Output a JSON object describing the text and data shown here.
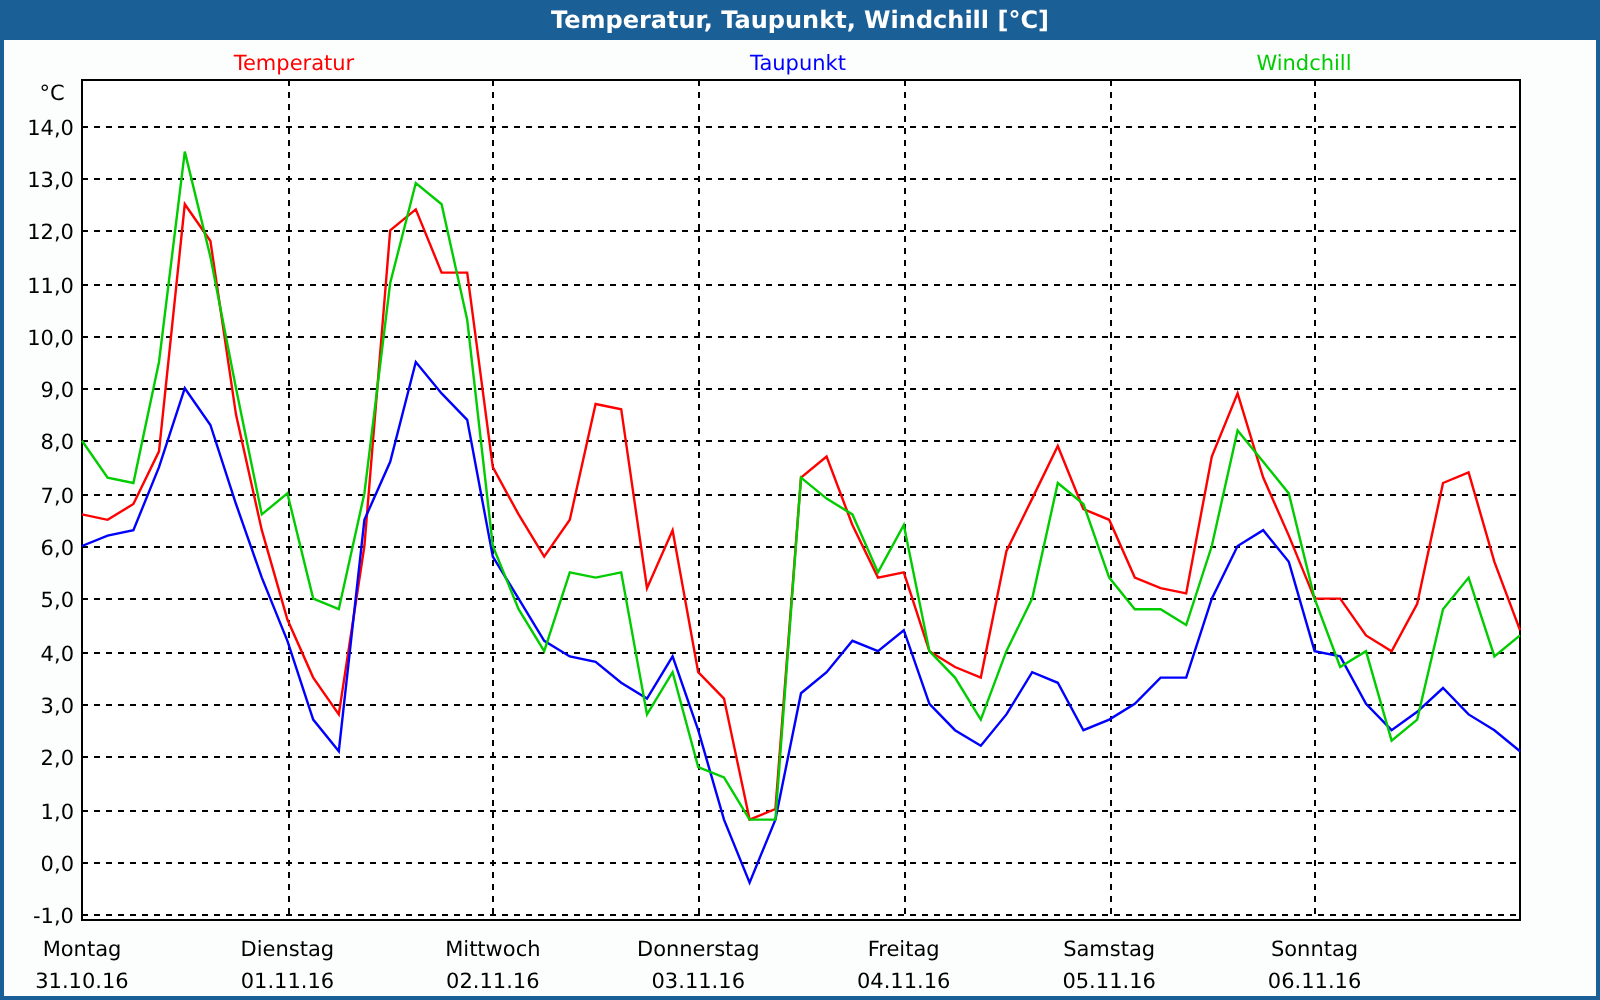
{
  "window": {
    "title": "Temperatur, Taupunkt, Windchill [°C]"
  },
  "chart": {
    "unit_label": "°C",
    "dates": [
      "31.10.16",
      "01.11.16",
      "02.11.16",
      "03.11.16",
      "04.11.16",
      "05.11.16",
      "06.11.16"
    ],
    "chart_data": {
      "type": "line",
      "categories": [
        "Montag",
        null,
        null,
        null,
        null,
        null,
        null,
        null,
        "Dienstag",
        null,
        null,
        null,
        null,
        null,
        null,
        null,
        "Mittwoch",
        null,
        null,
        null,
        null,
        null,
        null,
        null,
        "Donnerstag",
        null,
        null,
        null,
        null,
        null,
        null,
        null,
        "Freitag",
        null,
        null,
        null,
        null,
        null,
        null,
        null,
        "Samstag",
        null,
        null,
        null,
        null,
        null,
        null,
        null,
        "Sonntag",
        null,
        null,
        null,
        null,
        null,
        null,
        null,
        null
      ],
      "ylim": [
        -1.11,
        14.86
      ],
      "grid": true,
      "yticks": [
        {
          "value": 14,
          "label": "14,0"
        },
        {
          "value": 13,
          "label": "13,0"
        },
        {
          "value": 12,
          "label": "12,0"
        },
        {
          "value": 11,
          "label": "11,0"
        },
        {
          "value": 10,
          "label": "10,0"
        },
        {
          "value": 9,
          "label": "9,0"
        },
        {
          "value": 8,
          "label": "8,0"
        },
        {
          "value": 7,
          "label": "7,0"
        },
        {
          "value": 6,
          "label": "6,0"
        },
        {
          "value": 5,
          "label": "5,0"
        },
        {
          "value": 4,
          "label": "4,0"
        },
        {
          "value": 3,
          "label": "3,0"
        },
        {
          "value": 2,
          "label": "2,0"
        },
        {
          "value": 1,
          "label": "1,0"
        },
        {
          "value": 0,
          "label": "0,0"
        },
        {
          "value": -1,
          "label": "-1,0"
        }
      ],
      "series": [
        {
          "name": "Temperatur",
          "color": "#ff0000",
          "values": [
            6.6,
            6.5,
            6.8,
            7.8,
            12.5,
            11.8,
            8.5,
            6.3,
            4.6,
            3.5,
            2.8,
            6.0,
            12.0,
            12.4,
            11.2,
            11.2,
            7.5,
            6.6,
            5.8,
            6.5,
            8.7,
            8.6,
            5.2,
            6.3,
            3.6,
            3.1,
            0.8,
            1.0,
            7.3,
            7.7,
            6.4,
            5.4,
            5.5,
            4.0,
            3.7,
            3.5,
            5.9,
            6.9,
            7.9,
            6.7,
            6.5,
            5.4,
            5.2,
            5.1,
            7.7,
            8.9,
            7.3,
            6.2,
            5.0,
            5.0,
            4.3,
            4.0,
            4.9,
            7.2,
            7.4,
            5.7,
            4.4
          ]
        },
        {
          "name": "Taupunkt",
          "color": "#0000ff",
          "values": [
            6.0,
            6.2,
            6.3,
            7.5,
            9.0,
            8.3,
            6.8,
            5.4,
            4.2,
            2.7,
            2.1,
            6.5,
            7.6,
            9.5,
            8.9,
            8.4,
            5.8,
            5.0,
            4.2,
            3.9,
            3.8,
            3.4,
            3.1,
            3.9,
            2.5,
            0.8,
            -0.4,
            0.8,
            3.2,
            3.6,
            4.2,
            4.0,
            4.4,
            3.0,
            2.5,
            2.2,
            2.8,
            3.6,
            3.4,
            2.5,
            2.7,
            3.0,
            3.5,
            3.5,
            5.0,
            6.0,
            6.3,
            5.7,
            4.0,
            3.9,
            3.0,
            2.5,
            2.85,
            3.3,
            2.8,
            2.5,
            2.1
          ]
        },
        {
          "name": "Windchill",
          "color": "#00cc00",
          "values": [
            8.0,
            7.3,
            7.2,
            9.5,
            13.5,
            11.5,
            9.0,
            6.6,
            7.0,
            5.0,
            4.8,
            7.0,
            11.0,
            12.9,
            12.5,
            10.3,
            6.0,
            4.8,
            4.0,
            5.5,
            5.4,
            5.5,
            2.8,
            3.6,
            1.8,
            1.6,
            0.8,
            0.8,
            7.3,
            6.9,
            6.6,
            5.5,
            6.4,
            4.0,
            3.5,
            2.7,
            4.0,
            5.0,
            7.2,
            6.8,
            5.4,
            4.8,
            4.8,
            4.5,
            6.0,
            8.2,
            7.6,
            7.0,
            5.0,
            3.7,
            4.0,
            2.3,
            2.7,
            4.8,
            5.4,
            3.9,
            4.3
          ]
        }
      ]
    }
  }
}
